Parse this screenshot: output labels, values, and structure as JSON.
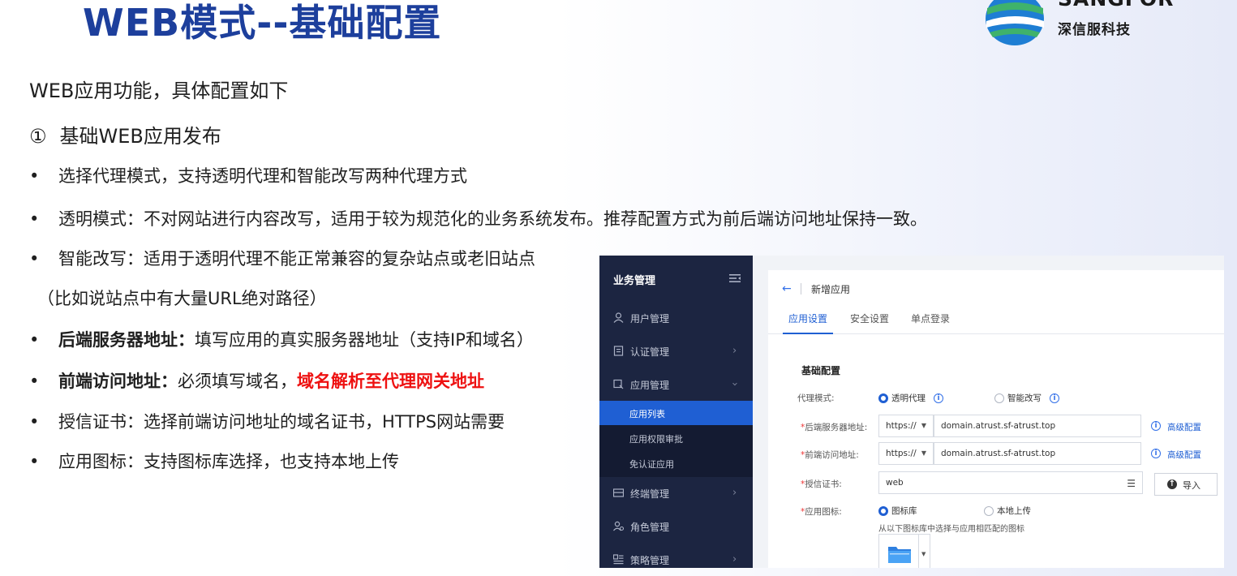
{
  "slide": {
    "title": "WEB模式--基础配置",
    "logo_brand": "SANGFOR",
    "logo_sub": "深信服科技",
    "intro": "WEB应用功能，具体配置如下",
    "subhead_num": "①",
    "subhead": "基础WEB应用发布",
    "bullet_glyph": "•",
    "b1": "选择代理模式，支持透明代理和智能改写两种代理方式",
    "b2": "透明模式：不对网站进行内容改写，适用于较为规范化的业务系统发布。推荐配置方式为前后端访问地址保持一致。",
    "b3": "智能改写：适用于透明代理不能正常兼容的复杂站点或老旧站点",
    "b3_cont": "（比如说站点中有大量URL绝对路径）",
    "b4_bold": "后端服务器地址：",
    "b4": "填写应用的真实服务器地址（支持IP和域名）",
    "b5_bold": "前端访问地址：",
    "b5": "必须填写域名，",
    "b5_red": "域名解析至代理网关地址",
    "b6": "授信证书：选择前端访问地址的域名证书，HTTPS网站需要",
    "b7": "应用图标：支持图标库选择，也支持本地上传",
    "accent_color": "#1d3f9c",
    "highlight_color": "#ee1111"
  },
  "app": {
    "sidebar": {
      "header": "业务管理",
      "items": [
        {
          "label": "用户管理",
          "icon": "user-icon"
        },
        {
          "label": "认证管理",
          "icon": "auth-icon"
        },
        {
          "label": "应用管理",
          "icon": "app-icon"
        },
        {
          "label": "终端管理",
          "icon": "terminal-icon"
        },
        {
          "label": "角色管理",
          "icon": "role-icon"
        },
        {
          "label": "策略管理",
          "icon": "policy-icon"
        }
      ],
      "subitems": [
        "应用列表",
        "应用权限审批",
        "免认证应用"
      ],
      "active_sub": "应用列表",
      "bg_color": "#1c2541",
      "active_color": "#1f5fd3"
    },
    "main": {
      "back": "←",
      "title": "新增应用",
      "tabs": [
        "应用设置",
        "安全设置",
        "单点登录"
      ],
      "active_tab": "应用设置",
      "section": "基础配置",
      "proxy_label": "代理模式:",
      "proxy_options": [
        "透明代理",
        "智能改写"
      ],
      "proxy_selected": "透明代理",
      "backend_label": "后端服务器地址:",
      "backend_scheme": "https://",
      "backend_value": "domain.atrust.sf-atrust.top",
      "frontend_label": "前端访问地址:",
      "frontend_scheme": "https://",
      "frontend_value": "domain.atrust.sf-atrust.top",
      "advanced_link": "高级配置",
      "cert_label": "授信证书:",
      "cert_value": "web",
      "import_button": "导入",
      "icon_label": "应用图标:",
      "icon_options": [
        "图标库",
        "本地上传"
      ],
      "icon_selected": "图标库",
      "icon_hint": "从以下图标库中选择与应用相匹配的图标"
    }
  }
}
